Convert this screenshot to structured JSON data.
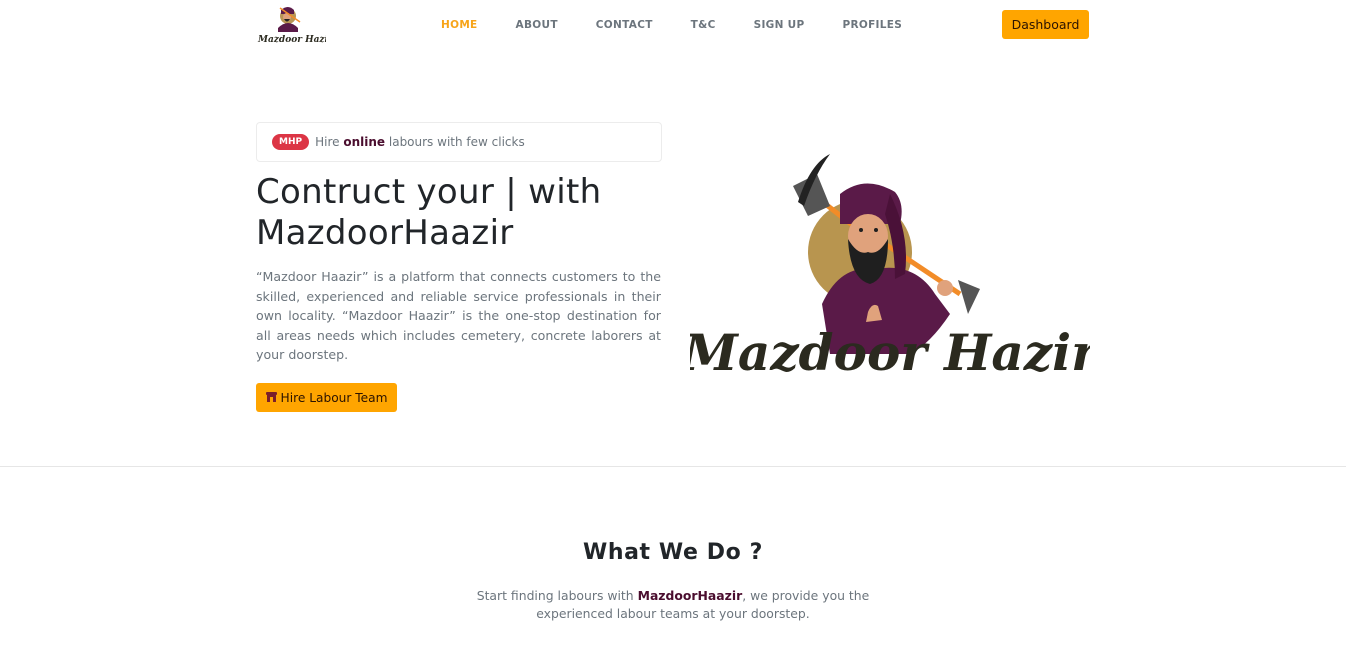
{
  "nav": {
    "logo_text": "Mazdoor Hazir",
    "links": [
      {
        "label": "HOME",
        "active": true
      },
      {
        "label": "ABOUT",
        "active": false
      },
      {
        "label": "CONTACT",
        "active": false
      },
      {
        "label": "T&C",
        "active": false
      },
      {
        "label": "SIGN UP",
        "active": false
      },
      {
        "label": "PROFILES",
        "active": false
      }
    ],
    "dashboard_label": "Dashboard"
  },
  "hero": {
    "badge": "MHP",
    "tagline_prefix": "Hire",
    "tagline_highlight": "online",
    "tagline_suffix": "labours with few clicks",
    "title": "Contruct your | with MazdoorHaazir",
    "description": "“Mazdoor Haazir” is a platform that connects customers to the skilled, experienced and reliable service professionals in their own locality. “Mazdoor Haazir” is the one-stop destination for all areas needs which includes cemetery, concrete laborers at your doorstep.",
    "cta_icon": "store-icon",
    "cta_label": "Hire Labour Team",
    "illustration_text": "Mazdoor Hazir"
  },
  "what_we_do": {
    "title": "What We Do ?",
    "desc_prefix": "Start finding labours with",
    "desc_brand": "MazdoorHaazir",
    "desc_suffix": ", we provide you the experienced labour teams at your doorstep."
  },
  "colors": {
    "accent": "#ffa500",
    "active_nav": "#f7a419",
    "brand_dark": "#4a0d2e",
    "badge": "#dc3545"
  }
}
